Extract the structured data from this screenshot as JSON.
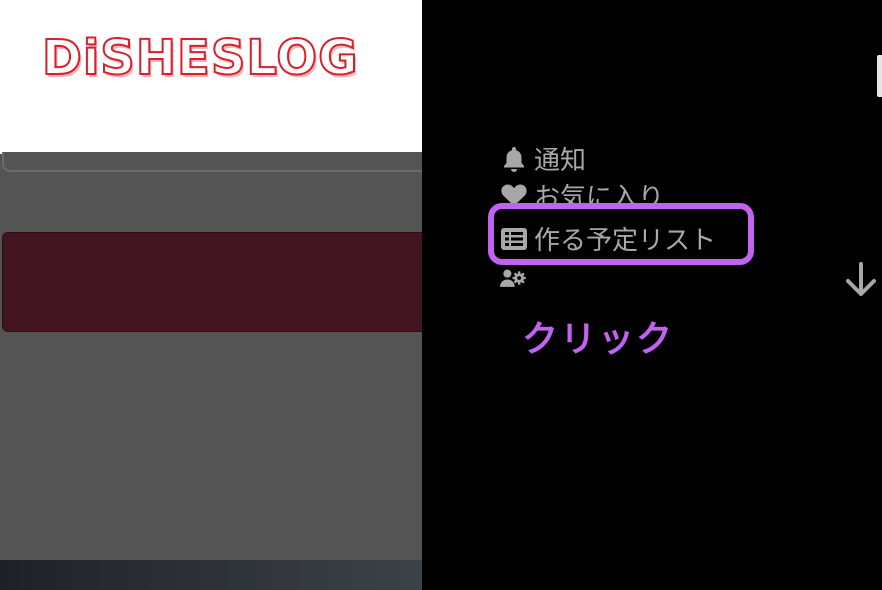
{
  "header": {
    "logo_text": "DiSHESLOG"
  },
  "drawer": {
    "menu": [
      {
        "label": "通知",
        "icon": "bell-icon"
      },
      {
        "label": "お気に入り",
        "icon": "heart-icon"
      },
      {
        "label": "作る予定リスト",
        "icon": "list-icon"
      },
      {
        "label": "",
        "icon": "user-settings-icon"
      }
    ],
    "annotation": {
      "label": "クリック",
      "color": "#c162f0"
    },
    "scroll_icon": "arrow-down-icon"
  },
  "colors": {
    "accent": "#c162f0",
    "logo_red": "#d8202c",
    "button_dark_red": "#431521",
    "menu_text": "#a8a8a8"
  }
}
